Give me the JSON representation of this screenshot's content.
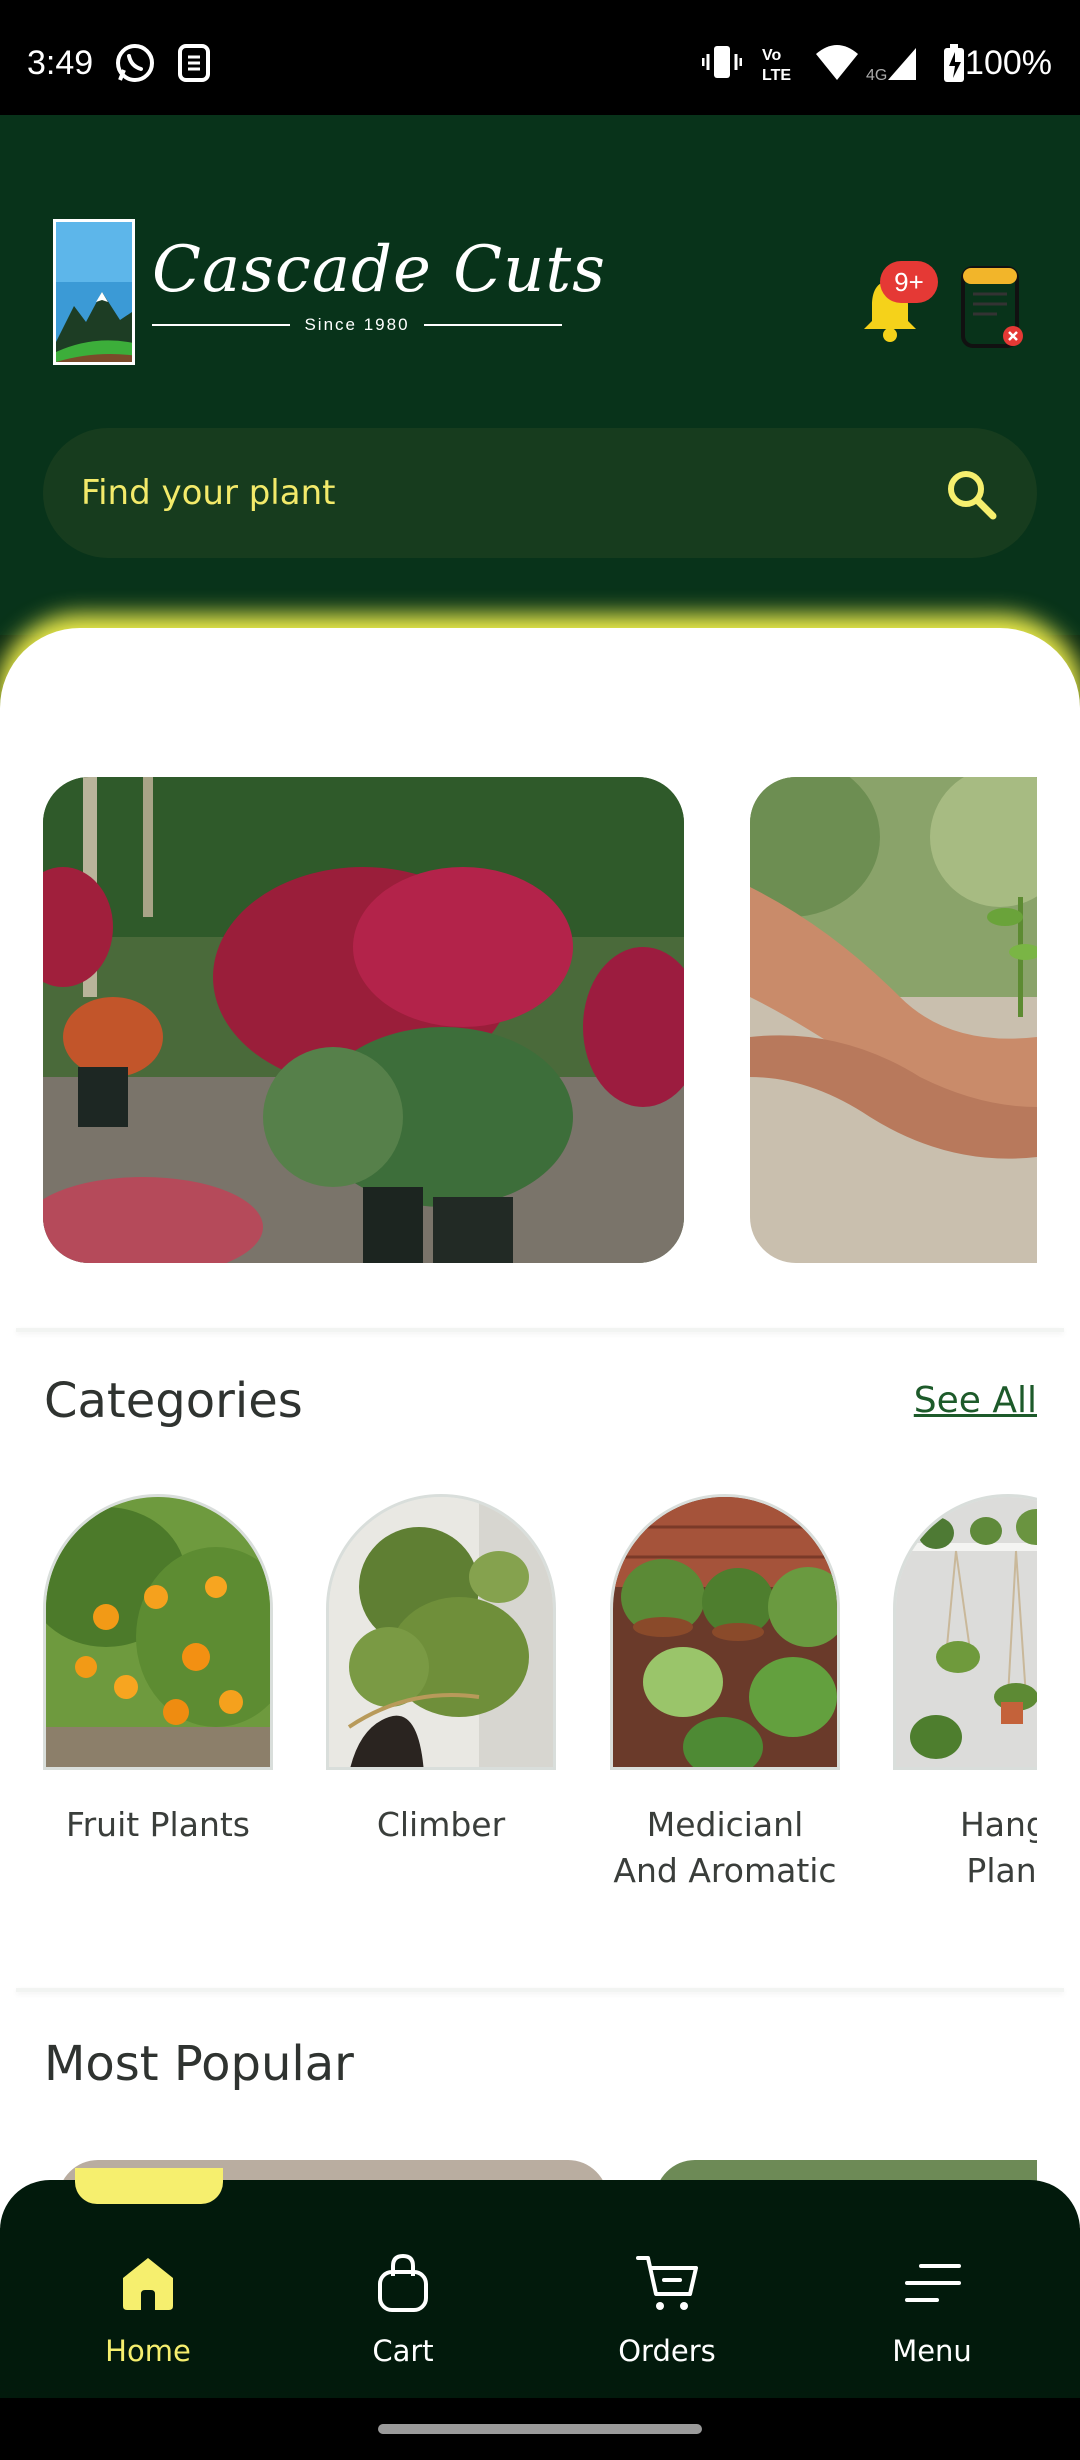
{
  "status_bar": {
    "time": "3:49",
    "battery": "100%",
    "icons": [
      "whatsapp-icon",
      "sim-app-icon",
      "vibrate-icon",
      "volte-icon",
      "wifi-icon",
      "signal-4g-icon",
      "battery-charging-icon"
    ]
  },
  "header": {
    "brand_name": "Cascade Cuts",
    "brand_tagline": "Since 1980",
    "notification_badge": "9+"
  },
  "search": {
    "placeholder": "Find your plant"
  },
  "categories": {
    "title": "Categories",
    "see_all": "See All",
    "items": [
      {
        "label_line1": "Fruit Plants",
        "label_line2": ""
      },
      {
        "label_line1": "Climber",
        "label_line2": ""
      },
      {
        "label_line1": "Medicianl",
        "label_line2": "And Aromatic"
      },
      {
        "label_line1": "Hangi",
        "label_line2": "Plant"
      }
    ]
  },
  "most_popular": {
    "title": "Most Popular"
  },
  "bottom_nav": {
    "items": [
      {
        "label": "Home",
        "icon": "home-icon",
        "active": true
      },
      {
        "label": "Cart",
        "icon": "bag-icon",
        "active": false
      },
      {
        "label": "Orders",
        "icon": "cart-icon",
        "active": false
      },
      {
        "label": "Menu",
        "icon": "menu-icon",
        "active": false
      }
    ]
  },
  "colors": {
    "header_bg": "#08331a",
    "accent_yellow": "#f6ef6e",
    "nav_bg": "#021a0c",
    "badge_red": "#e53935"
  }
}
